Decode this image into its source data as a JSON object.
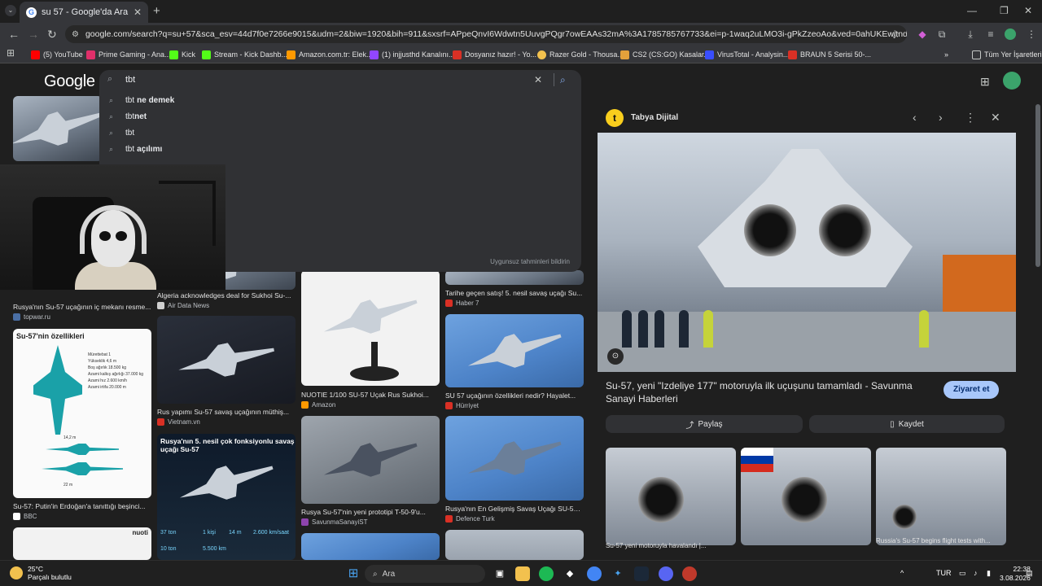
{
  "browser": {
    "tab_title": "su 57 - Google'da Ara",
    "tab_favicon": "G",
    "new_tab": "+",
    "url": "google.com/search?q=su+57&sca_esv=44d7f0e7266e9015&udm=2&biw=1920&bih=911&sxsrf=APpeQnvI6Wdwtn5UuvgPQgr7owEAAs32mA%3A1785785767733&ei=p-1waq2uLMO3i-gPkZzeoAo&ved=0ahUKEwjtndKymoWWAxXD2wI..."
  },
  "bookmarks": [
    {
      "label": "(5) YouTube",
      "color": "#ff0000"
    },
    {
      "label": "Prime Gaming - Ana...",
      "color": "#e02f6a"
    },
    {
      "label": "Kick",
      "color": "#53fc18"
    },
    {
      "label": "Stream - Kick Dashb...",
      "color": "#53fc18"
    },
    {
      "label": "Amazon.com.tr: Elek...",
      "color": "#ff9900"
    },
    {
      "label": "(1) injjusthd Kanalını...",
      "color": "#9146ff"
    },
    {
      "label": "Dosyanız hazır! - Yo...",
      "color": "#d93025"
    },
    {
      "label": "Razer Gold - Thousa...",
      "color": "#f2c14e"
    },
    {
      "label": "CS2 (CS:GO) Kasalar...",
      "color": "#e3a13b"
    },
    {
      "label": "VirusTotal - Analysin...",
      "color": "#394eff"
    },
    {
      "label": "BRAUN 5 Serisi 50-...",
      "color": "#d93025"
    }
  ],
  "bookmarks_more": "Tüm Yer İşaretleri",
  "google": {
    "logo": "Google",
    "query": "tbt",
    "suggestions": [
      {
        "prefix": "tbt",
        "rest": "ne demek"
      },
      {
        "prefix": "tbt",
        "rest": "net"
      },
      {
        "prefix": "tbt",
        "rest": ""
      },
      {
        "prefix": "tbt",
        "rest": "açılımı"
      }
    ],
    "report_link": "Uygunsuz tahminleri bildirin"
  },
  "results": [
    {
      "title": "Rusya'nın Su-57 uçağının iç mekanı resme...",
      "source": "topwar.ru"
    },
    {
      "title": "Algeria acknowledges deal for Sukhoi Su-...",
      "source": "Air Data News"
    },
    {
      "title": "Tarihe geçen satış! 5. nesil savaş uçağı Su...",
      "source": "Haber 7"
    },
    {
      "title": "NUOTIE 1/100 SU-57 Uçak Rus Sukhoi...",
      "source": "Amazon"
    },
    {
      "title": "SU 57 uçağının özellikleri nedir? Hayalet...",
      "source": "Hürriyet"
    },
    {
      "title": "Rus yapımı Su-57 savaş uçağının müthiş...",
      "source": "Vietnam.vn"
    },
    {
      "title": "Su-57: Putin'in Erdoğan'a tanıttığı beşinci...",
      "source": "BBC"
    },
    {
      "title": "Rusya Su-57'nin yeni prototipi T-50-9'u...",
      "source": "SavunmaSanayiST"
    },
    {
      "title": "Rusya'nın En Gelişmiş Savaş Uçağı SU-57 i...",
      "source": "Defence Turk"
    }
  ],
  "infographic": {
    "title": "Su-57'nin özellikleri",
    "lines": [
      "Mürettebat 1",
      "Yükseklik 4,6 m",
      "Boş ağırlık 18.500 kg",
      "Azami kalkış ağırlığı 37.000 kg",
      "Azami hız 2.600 km/h",
      "Azami irtifa 20.000 m"
    ],
    "dim1": "14,2 m",
    "dim2": "22 m"
  },
  "night_card": {
    "title": "Rusya'nın 5. nesil çok fonksiyonlu savaş uçağı Su-57",
    "stats": [
      "37 ton",
      "1 kişi",
      "14 m",
      "2.600 km/saat",
      "10 ton",
      "5.500 km"
    ]
  },
  "model_card_brand": "nuoti",
  "panel": {
    "source": "Tabya Dijital",
    "title": "Su-57, yeni \"Izdeliye 177\" motoruyla ilk uçuşunu tamamladı - Savunma Sanayi Haberleri",
    "visit": "Ziyaret et",
    "share": "Paylaş",
    "save": "Kaydet",
    "related": [
      {
        "title": "Su-57 yeni motoruyla havalandı |..."
      },
      {
        "title": ""
      },
      {
        "title": "Russia's Su-57 begins flight tests with..."
      }
    ]
  },
  "taskbar": {
    "temp": "25°C",
    "weather": "Parçalı bulutlu",
    "search": "Ara",
    "lang": "TUR",
    "time": "22:38",
    "date": "3.08.2026"
  }
}
